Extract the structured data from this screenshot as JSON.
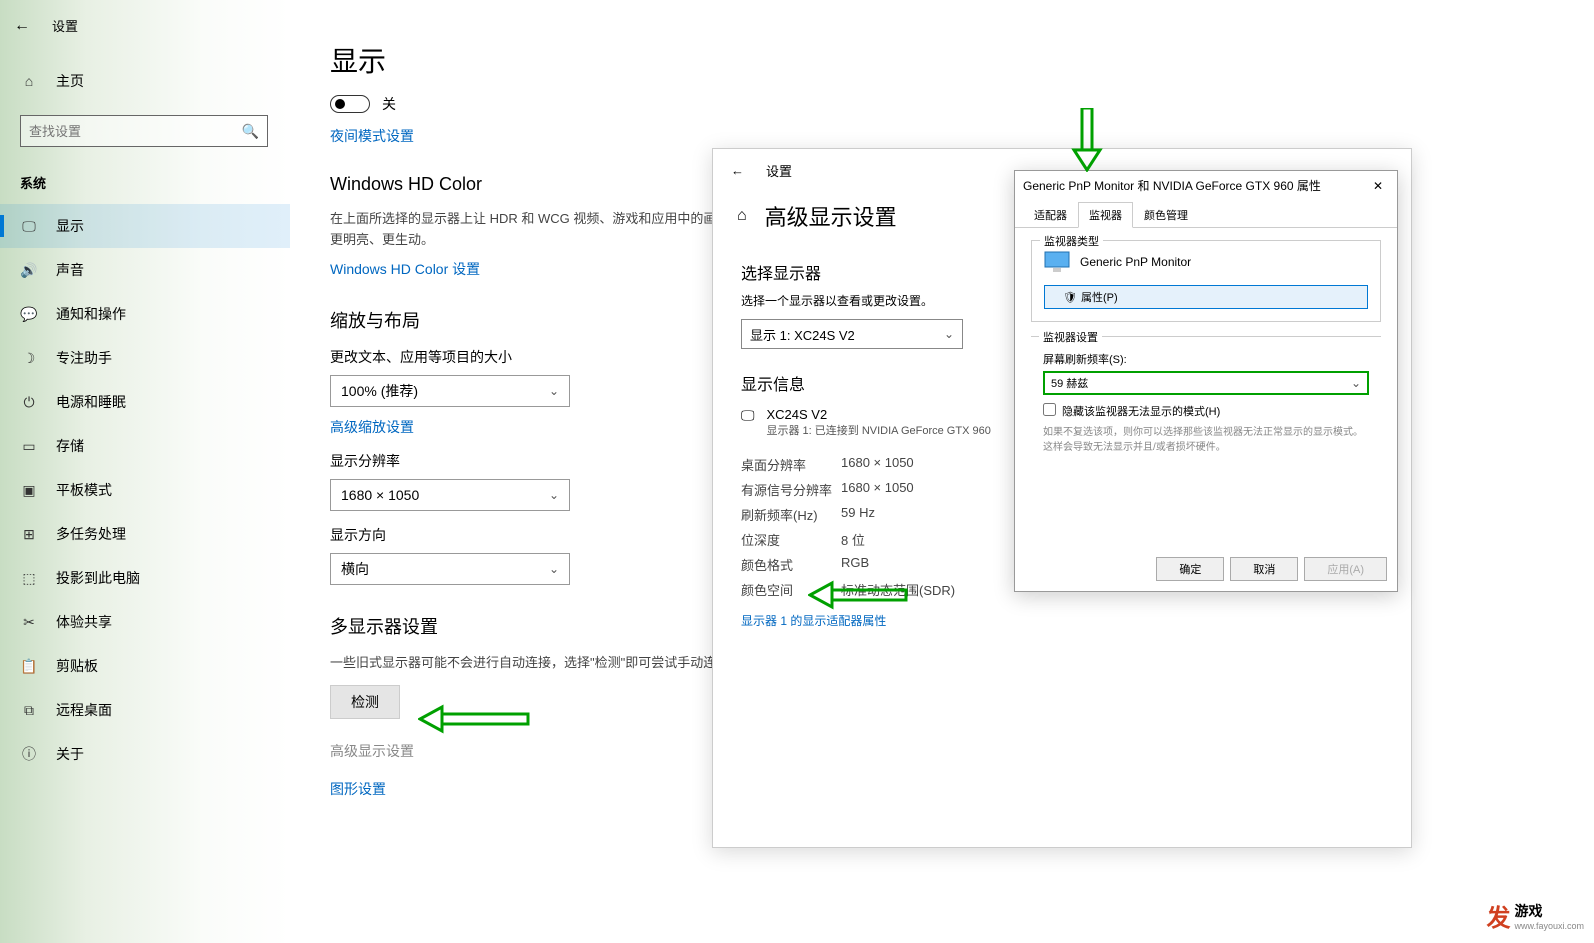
{
  "window1": {
    "title": "设置",
    "home": "主页",
    "search_placeholder": "查找设置",
    "category": "系统",
    "nav": {
      "display": "显示",
      "sound": "声音",
      "notifications": "通知和操作",
      "focus": "专注助手",
      "power": "电源和睡眠",
      "storage": "存储",
      "tablet": "平板模式",
      "multitask": "多任务处理",
      "project": "投影到此电脑",
      "shared": "体验共享",
      "clipboard": "剪贴板",
      "remote": "远程桌面",
      "about": "关于"
    },
    "content": {
      "h1": "显示",
      "toggle_off": "关",
      "night_link": "夜间模式设置",
      "hd_title": "Windows HD Color",
      "hd_desc": "在上面所选择的显示器上让 HDR 和 WCG 视频、游戏和应用中的画面更明亮、更生动。",
      "hd_link": "Windows HD Color 设置",
      "scale_title": "缩放与布局",
      "scale_label": "更改文本、应用等项目的大小",
      "scale_val": "100% (推荐)",
      "scale_link": "高级缩放设置",
      "res_label": "显示分辨率",
      "res_val": "1680 × 1050",
      "orient_label": "显示方向",
      "orient_val": "横向",
      "multi_title": "多显示器设置",
      "multi_desc": "一些旧式显示器可能不会进行自动连接，选择\"检测\"即可尝试手动连接。",
      "detect_btn": "检测",
      "adv_link": "高级显示设置",
      "gfx_link": "图形设置"
    }
  },
  "window2": {
    "title": "设置",
    "h2": "高级显示设置",
    "select_title": "选择显示器",
    "select_desc": "选择一个显示器以查看或更改设置。",
    "select_val": "显示 1: XC24S V2",
    "info_title": "显示信息",
    "monitor_name": "XC24S V2",
    "monitor_sub": "显示器 1: 已连接到 NVIDIA GeForce GTX 960",
    "rows": {
      "desktop_res_l": "桌面分辨率",
      "desktop_res_v": "1680 × 1050",
      "active_res_l": "有源信号分辨率",
      "active_res_v": "1680 × 1050",
      "refresh_l": "刷新频率(Hz)",
      "refresh_v": "59 Hz",
      "depth_l": "位深度",
      "depth_v": "8 位",
      "format_l": "颜色格式",
      "format_v": "RGB",
      "space_l": "颜色空间",
      "space_v": "标准动态范围(SDR)"
    },
    "adapter_link": "显示器 1 的显示适配器属性"
  },
  "window3": {
    "title": "Generic PnP Monitor 和 NVIDIA GeForce GTX 960 属性",
    "tabs": {
      "adapter": "适配器",
      "monitor": "监视器",
      "color": "颜色管理"
    },
    "group_type": "监视器类型",
    "monitor_name": "Generic PnP Monitor",
    "prop_btn": "属性(P)",
    "group_settings": "监视器设置",
    "rate_label": "屏幕刷新频率(S):",
    "rate_val": "59 赫兹",
    "hide_checkbox": "隐藏该监视器无法显示的模式(H)",
    "hide_desc": "如果不复选该项，则你可以选择那些该监视器无法正常显示的显示模式。这样会导致无法显示并且/或者损坏硬件。",
    "ok": "确定",
    "cancel": "取消",
    "apply": "应用(A)"
  },
  "watermark": {
    "brand": "发",
    "text": "游戏",
    "url": "www.fayouxi.com"
  }
}
